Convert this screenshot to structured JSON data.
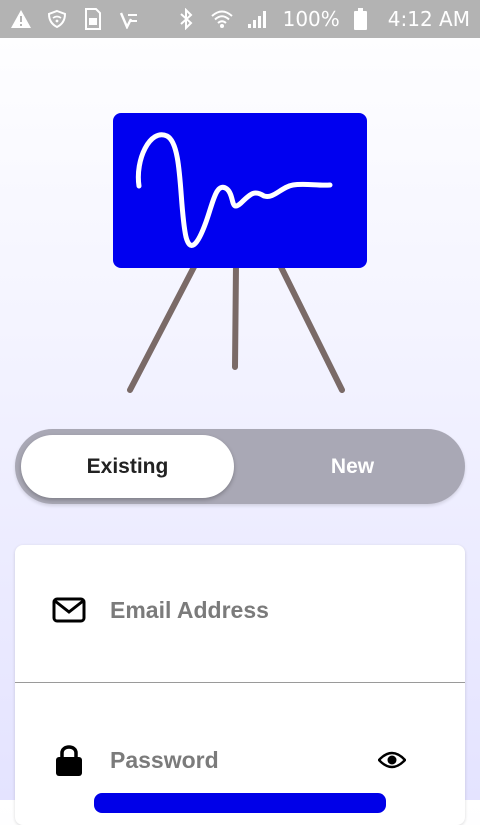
{
  "status_bar": {
    "left_icons": [
      "warning-icon",
      "shield-wifi-icon",
      "sim-card-icon",
      "tasks-icon"
    ],
    "right_icons": [
      "bluetooth-icon",
      "wifi-icon",
      "signal-icon",
      "battery-icon"
    ],
    "battery": "100%",
    "time": "4:12 AM"
  },
  "illustration": {
    "name": "signature-easel",
    "board_color": "#0000f0",
    "leg_color": "#7a6a67"
  },
  "toggle": {
    "options": [
      "Existing",
      "New"
    ],
    "selected": "Existing"
  },
  "form": {
    "email": {
      "placeholder": "Email Address",
      "value": "",
      "icon": "envelope-icon"
    },
    "password": {
      "placeholder": "Password",
      "value": "",
      "icon": "lock-icon",
      "toggle_icon": "eye-icon"
    }
  },
  "colors": {
    "accent": "#0000e8",
    "status_bar": "#b3b3b3",
    "toggle_bg": "#a9a8b5"
  }
}
